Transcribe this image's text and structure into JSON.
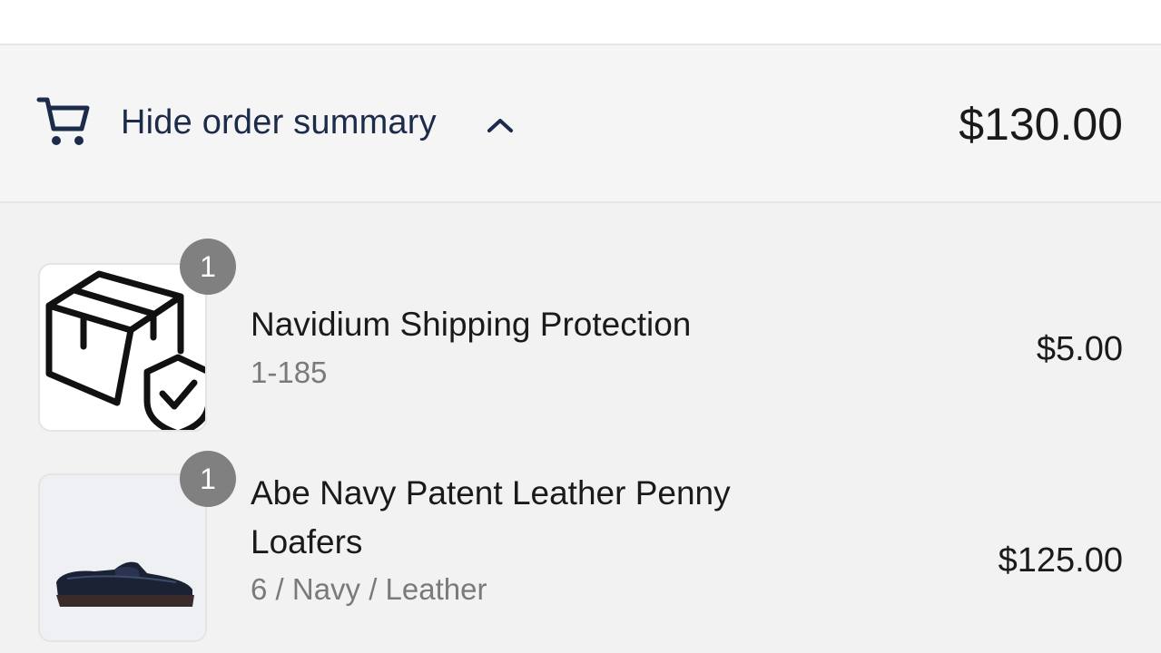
{
  "colors": {
    "toggle_text": "#1c2b4a",
    "toggle_background": "#f5f5f5",
    "items_background": "#f2f2f2",
    "quantity_badge": "#808080"
  },
  "summary_toggle": {
    "icon": "cart-icon",
    "label": "Hide order summary",
    "chevron_icon": "chevron-up-icon",
    "total": "$130.00"
  },
  "line_items": [
    {
      "image_icon": "shipping-protection-box-shield-icon",
      "quantity": "1",
      "title": "Navidium Shipping Protection",
      "variant": "1-185",
      "price": "$5.00"
    },
    {
      "image_icon": "penny-loafer-shoe-image",
      "quantity": "1",
      "title_line1": "Abe Navy Patent Leather Penny",
      "title_line2": "Loafers",
      "variant": "6 / Navy / Leather",
      "price": "$125.00"
    }
  ]
}
